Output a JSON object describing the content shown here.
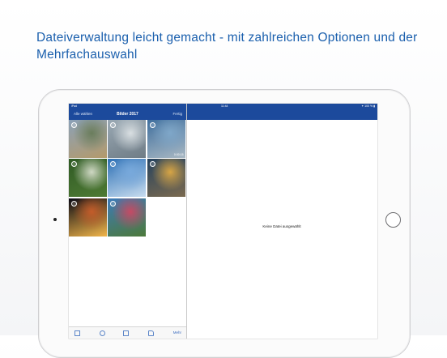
{
  "headline": "Dateiverwaltung leicht gemacht - mit zahlreichen Optionen und der Mehrfachauswahl",
  "status": {
    "left": "iPad ",
    "time": "11:44",
    "right": "✦ 100 % ▮"
  },
  "nav": {
    "edit_label": "Alle wählen",
    "title": "Bilder 2017",
    "done_label": "Fertig"
  },
  "photos": [
    {
      "name": "palace",
      "colors": [
        "#8aa1b8",
        "#6a7d5c",
        "#b49a6b"
      ]
    },
    {
      "name": "sun-sky",
      "colors": [
        "#9aa9b4",
        "#d9dfe2",
        "#6f7c86"
      ]
    },
    {
      "name": "blue-sky-video",
      "colors": [
        "#3f6f9e",
        "#7fa7c9",
        "#a9b8c3"
      ],
      "duration": "0:00:15"
    },
    {
      "name": "white-flower",
      "colors": [
        "#2f5a24",
        "#cfd8c4",
        "#4e7a34"
      ]
    },
    {
      "name": "clear-sky",
      "colors": [
        "#2c6fb4",
        "#78a9dc",
        "#c7dcef"
      ]
    },
    {
      "name": "sunset-clouds",
      "colors": [
        "#25425e",
        "#d7a545",
        "#7b6a4f"
      ]
    },
    {
      "name": "ferris-wheel",
      "colors": [
        "#0a0a14",
        "#c45c2a",
        "#f2b64a"
      ]
    },
    {
      "name": "flower-garden",
      "colors": [
        "#3d7ab8",
        "#c54a64",
        "#4d7a3a"
      ]
    }
  ],
  "tabbar": {
    "action_label": "Mehr"
  },
  "detail": {
    "empty_text": "Keine Datei ausgewählt"
  }
}
